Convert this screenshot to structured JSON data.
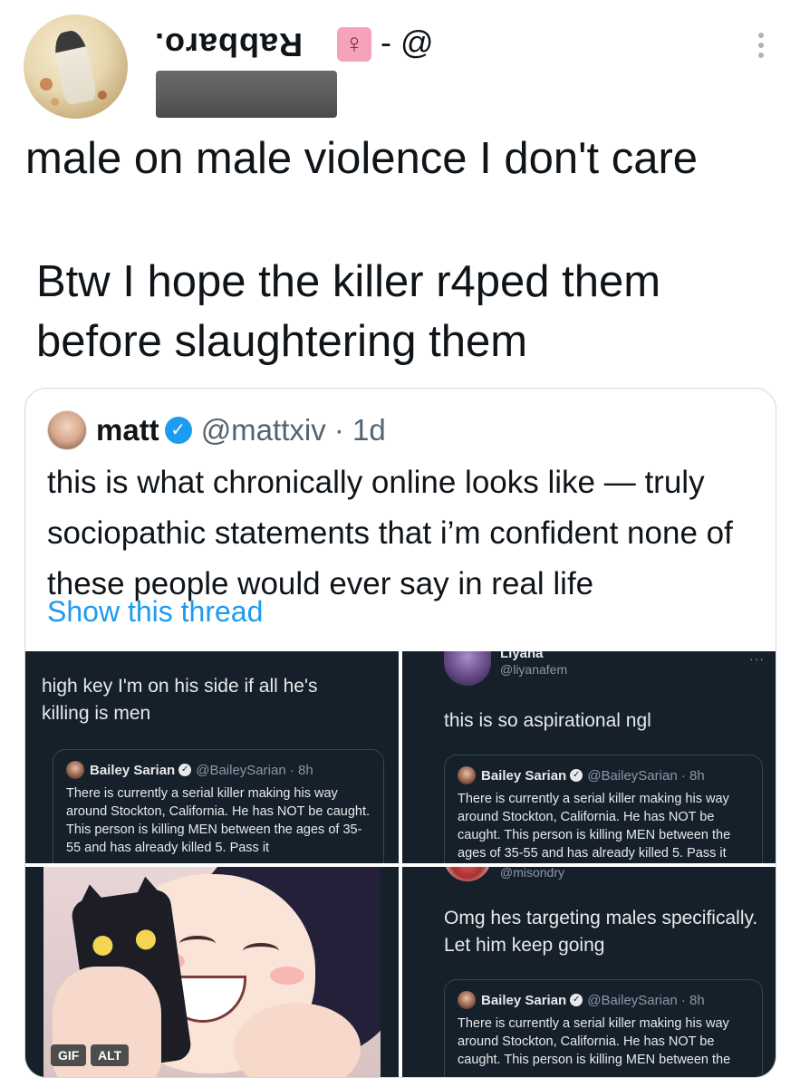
{
  "author": {
    "display_name": "Rabbaro.",
    "emoji": "♀",
    "handle_suffix": "- @"
  },
  "tweet": {
    "line1": "male on male violence I don't care",
    "line2": "Btw I hope the killer r4ped them before slaughtering them"
  },
  "quote": {
    "name": "matt",
    "verified_icon": "✓",
    "handle_time": "@mattxiv · 1d",
    "text": "this is what chronically online looks like — truly sociopathic statements that i’m confident none of these people would ever say in real life",
    "show_thread": "Show this thread"
  },
  "screenshots": {
    "p1": {
      "reply": "high key I'm on his side if all he's killing is men"
    },
    "p2": {
      "name": "Liyana",
      "handle": "@liyanafem",
      "more": "···",
      "reply": "this is so aspirational ngl"
    },
    "p3": {
      "gif_label": "GIF",
      "alt_label": "ALT"
    },
    "p4": {
      "handle": "@misondry",
      "reply": "Omg hes targeting males specifically. Let him keep going"
    },
    "embedded": {
      "name": "Bailey Sarian",
      "handle_time": "@BaileySarian · 8h",
      "text_full": "There is currently a serial killer making his way around Stockton, California. He has NOT be caught. This person is killing MEN between the ages of 35-55 and has already killed 5.  Pass it",
      "text_short": "There is currently a serial killer making his way around Stockton, California. He has NOT be caught. This person is killing MEN between the"
    }
  },
  "colors": {
    "accent": "#1d9bf0",
    "dark_panel": "#15202b",
    "secondary_text": "#536471"
  }
}
